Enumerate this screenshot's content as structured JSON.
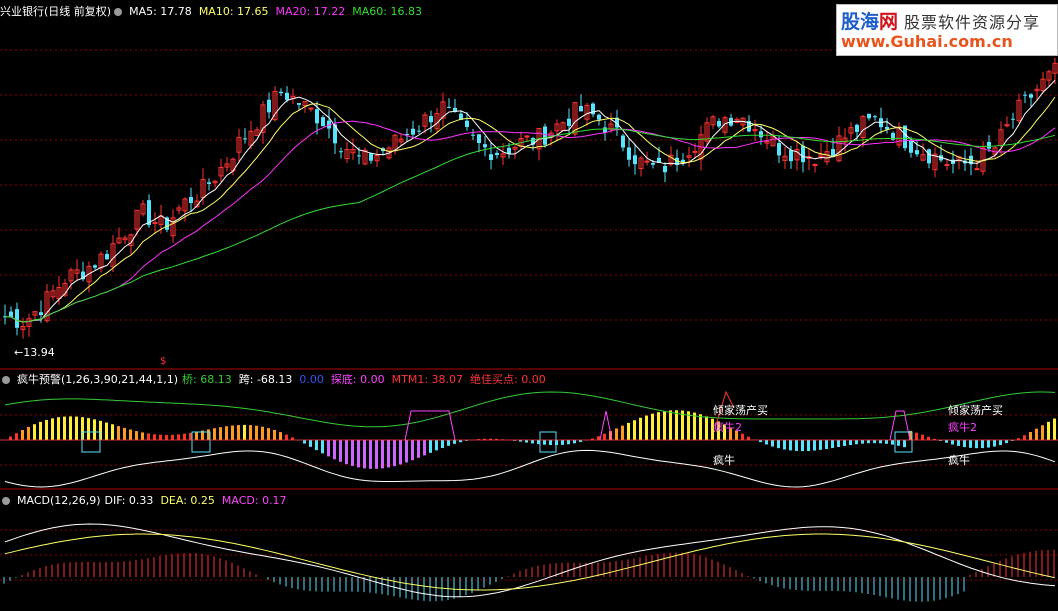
{
  "main_panel": {
    "title": "兴业银行(日线 前复权)",
    "indicators": [
      {
        "label": "MA5: 17.78",
        "color": "#ffffff"
      },
      {
        "label": "MA10: 17.65",
        "color": "#ffff66"
      },
      {
        "label": "MA20: 17.22",
        "color": "#ff33ff"
      },
      {
        "label": "MA60: 16.83",
        "color": "#33dd33"
      }
    ],
    "low_label": "←13.94",
    "marker_glyph": "$"
  },
  "panel2": {
    "title": "疯牛预警(1,26,3,90,21,44,1,1)",
    "indicators": [
      {
        "label": "桥: 68.13",
        "color": "#33cc33"
      },
      {
        "label": "跨: -68.13",
        "color": "#ffffff"
      },
      {
        "label": "0.00",
        "color": "#3355ff"
      },
      {
        "label": "探底: 0.00",
        "color": "#ff44ff"
      },
      {
        "label": "MTM1: 38.07",
        "color": "#ff3333"
      },
      {
        "label": "绝佳买点: 0.00",
        "color": "#ff3333"
      }
    ],
    "annotations": {
      "signal_a": "倾家荡产买",
      "signal_b": "疯牛2",
      "signal_c": "疯牛",
      "signal_d": "倾家荡产买",
      "signal_e": "疯牛2",
      "signal_f": "疯牛"
    }
  },
  "panel3": {
    "title": "MACD(12,26,9)",
    "indicators": [
      {
        "label": "DIF: 0.33",
        "color": "#ffffff"
      },
      {
        "label": "DEA: 0.25",
        "color": "#ffff66"
      },
      {
        "label": "MACD: 0.17",
        "color": "#ff44ff"
      }
    ]
  },
  "watermark": {
    "brand_a": "股海",
    "brand_b": "网",
    "slogan": "股票软件资源分享",
    "url": "www.Guhai.com.cn"
  },
  "colors": {
    "up": "#ff3333",
    "down": "#55e5ff",
    "grid": "#8b0000",
    "separator": "#b00000"
  },
  "chart_data": {
    "type": "candlestick",
    "title": "兴业银行(日线 前复权)",
    "price_range": [
      13.5,
      19.6
    ],
    "lowest_price": 13.94,
    "moving_averages": {
      "MA5": 17.78,
      "MA10": 17.65,
      "MA20": 17.22,
      "MA60": 16.83
    },
    "close_path": [
      14.1,
      14.0,
      14.4,
      14.9,
      15.1,
      15.4,
      15.9,
      16.3,
      16.0,
      16.5,
      16.8,
      17.3,
      17.9,
      18.4,
      18.9,
      18.6,
      18.3,
      17.8,
      17.4,
      17.6,
      17.9,
      18.2,
      18.6,
      18.1,
      17.7,
      17.6,
      17.8,
      17.9,
      18.2,
      18.5,
      18.3,
      17.9,
      17.4,
      17.2,
      17.5,
      17.9,
      18.3,
      18.4,
      18.1,
      17.7,
      17.6,
      17.5,
      17.8,
      18.1,
      18.3,
      18.0,
      17.7,
      17.5,
      17.3,
      17.4,
      17.7,
      18.4,
      18.9,
      19.3
    ]
  }
}
